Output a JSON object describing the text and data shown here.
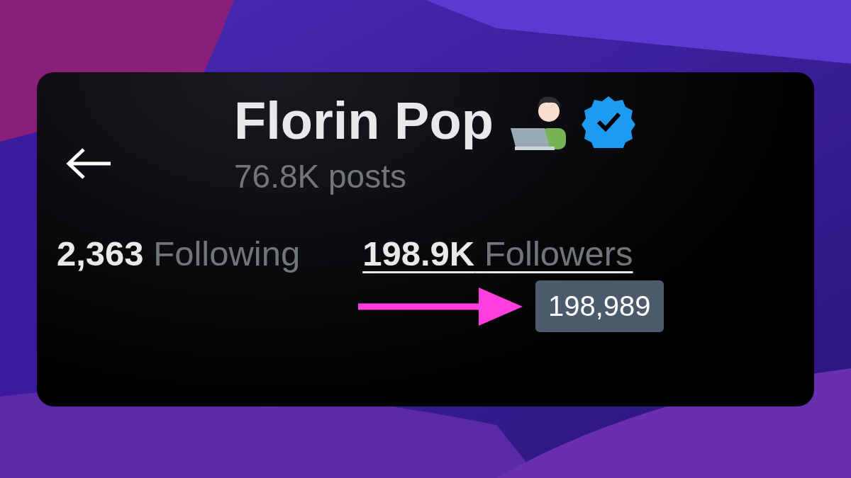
{
  "header": {
    "name": "Florin Pop",
    "verified": true,
    "posts": "76.8K posts"
  },
  "stats": [
    {
      "count": "2,363",
      "label": "Following",
      "hovered": false
    },
    {
      "count": "198.9K",
      "label": "Followers",
      "hovered": true
    }
  ],
  "tooltip": {
    "text": "198,989"
  }
}
